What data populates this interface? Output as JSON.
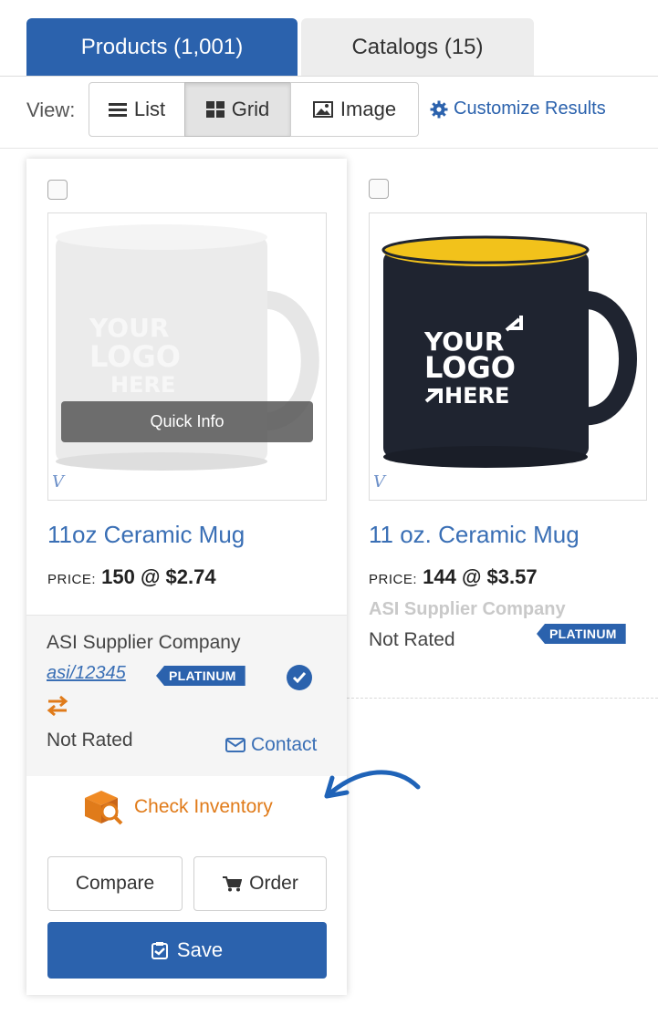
{
  "tabs": [
    {
      "label": "Products (1,001)",
      "active": true
    },
    {
      "label": "Catalogs (15)",
      "active": false
    }
  ],
  "view": {
    "label": "View:",
    "buttons": [
      {
        "label": "List",
        "icon": "list-icon",
        "selected": false
      },
      {
        "label": "Grid",
        "icon": "grid-icon",
        "selected": true
      },
      {
        "label": "Image",
        "icon": "image-icon",
        "selected": false
      }
    ],
    "customize_label": "Customize Results"
  },
  "products": [
    {
      "title": "11oz Ceramic Mug",
      "price_label": "PRICE:",
      "price_value": "150 @ $2.74",
      "image": {
        "mug_color": "#e9e9e9",
        "interior_color": "#f2f2f2",
        "logo_text": [
          "YOUR",
          "LOGO",
          "HERE"
        ]
      },
      "quick_info_label": "Quick Info",
      "supplier": "ASI Supplier Company",
      "asi_number": "asi/12345",
      "badge": "PLATINUM",
      "rating": "Not Rated",
      "contact_label": "Contact",
      "check_inventory_label": "Check Inventory",
      "compare_label": "Compare",
      "order_label": "Order",
      "save_label": "Save"
    },
    {
      "title": "11 oz. Ceramic Mug",
      "price_label": "PRICE:",
      "price_value": "144 @ $3.57",
      "image": {
        "mug_color": "#1f2430",
        "interior_color": "#f2c21b",
        "logo_text": [
          "YOUR",
          "LOGO",
          "HERE"
        ]
      },
      "supplier": "ASI Supplier Company",
      "badge": "PLATINUM",
      "rating": "Not Rated"
    }
  ],
  "colors": {
    "brand_blue": "#2b62ad",
    "link_blue": "#3a6fb5",
    "inventory_orange": "#e07b1a"
  }
}
